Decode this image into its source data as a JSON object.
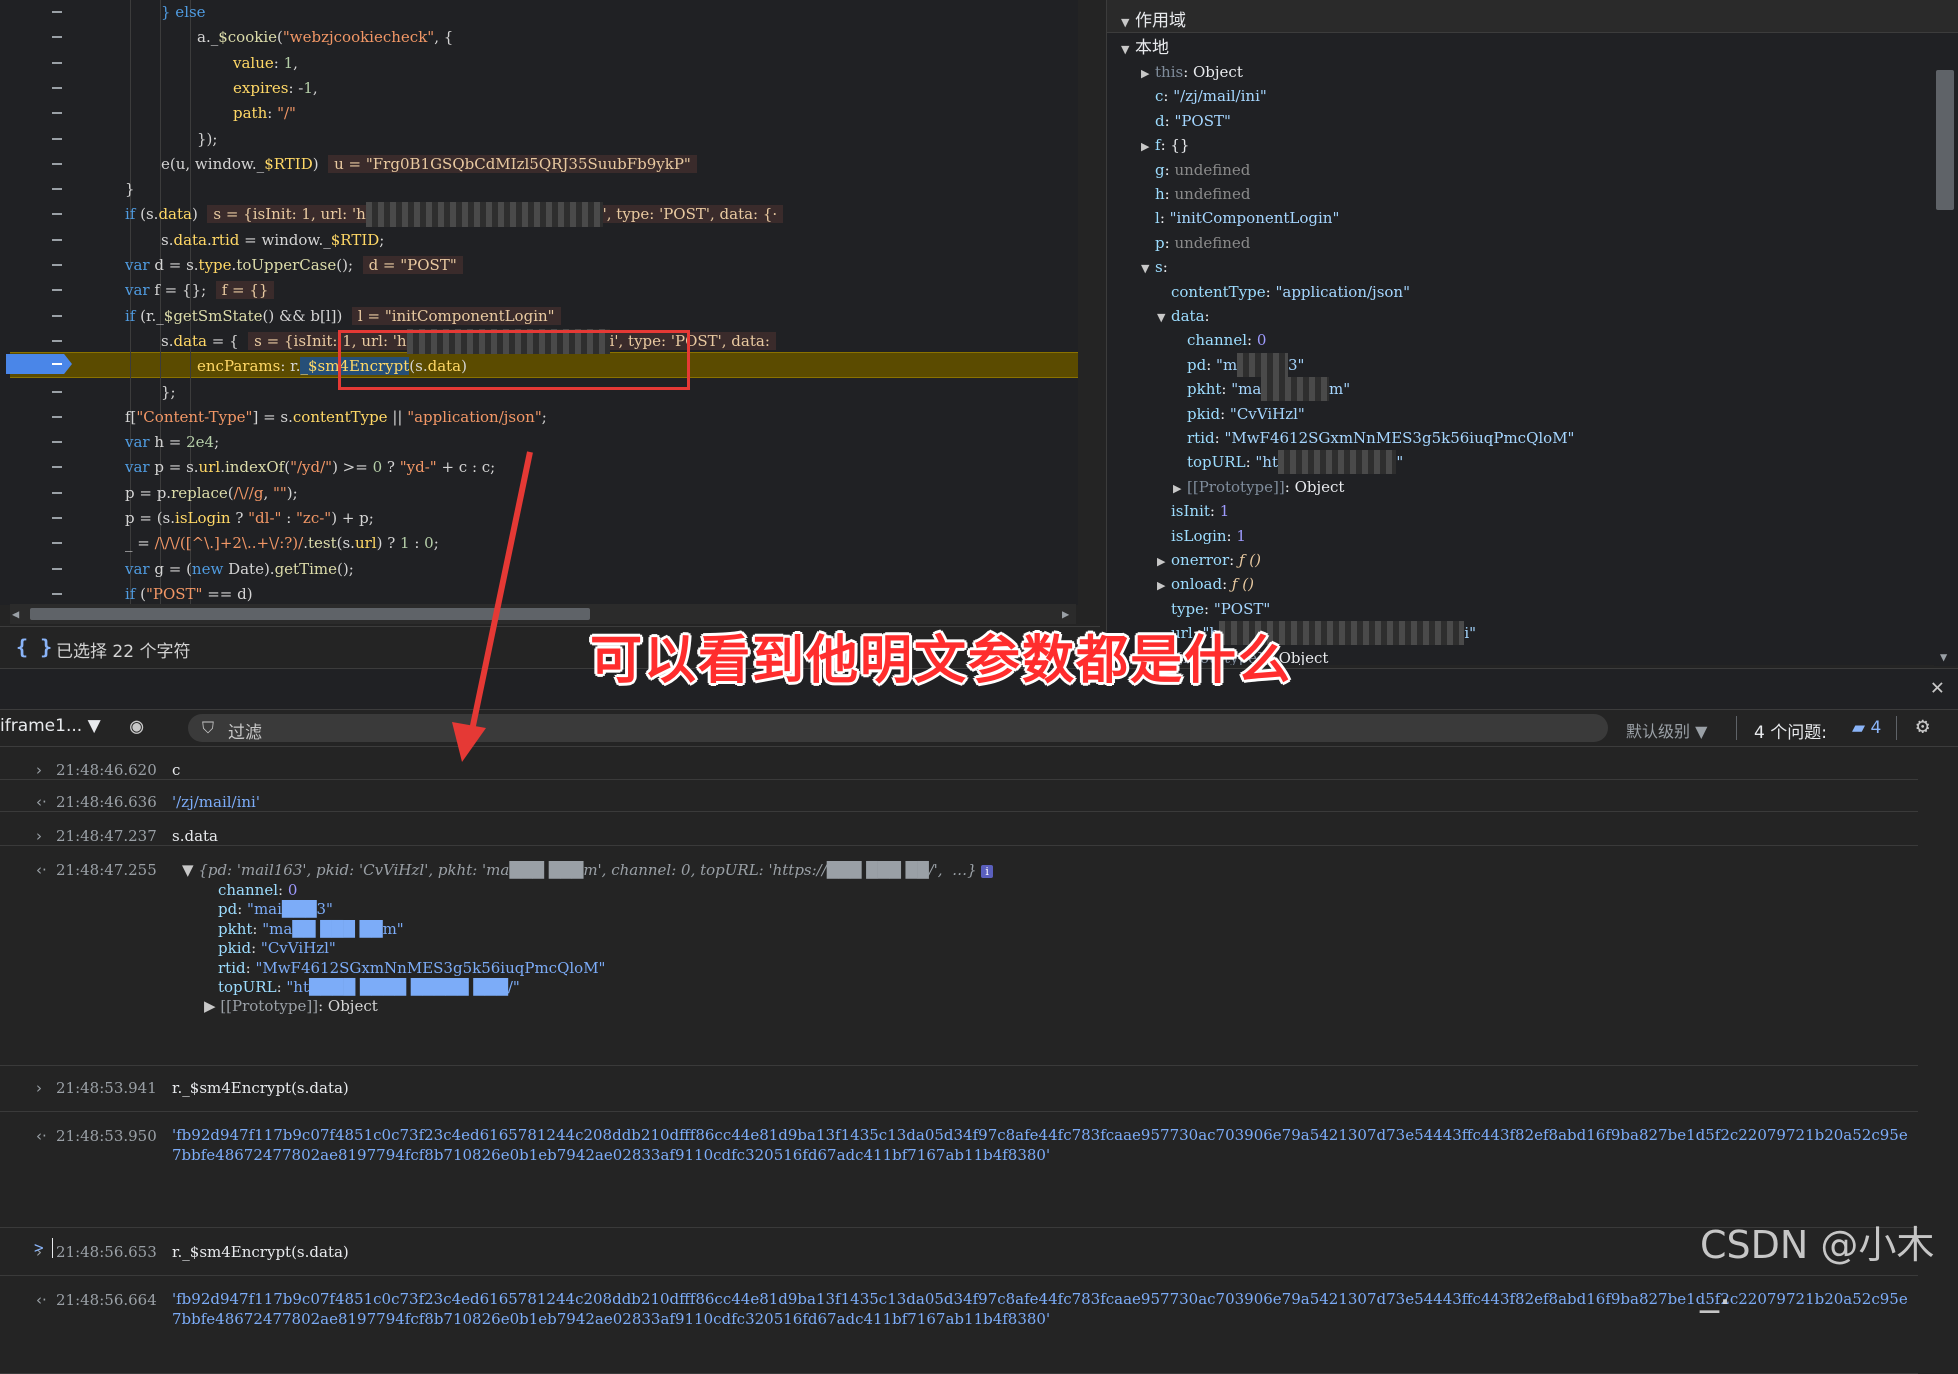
{
  "source": {
    "lines": [
      {
        "indent": 3,
        "html": "<span class='kw'>} else</span>"
      },
      {
        "indent": 4,
        "html": "a._<span class='fn'>$cookie</span>(<span class='str'>\"webzjcookiecheck\"</span>, {"
      },
      {
        "indent": 5,
        "html": "<span class='prop'>value</span>: <span class='num'>1</span>,"
      },
      {
        "indent": 5,
        "html": "<span class='prop'>expires</span>: -<span class='num'>1</span>,"
      },
      {
        "indent": 5,
        "html": "<span class='prop'>path</span>: <span class='str'>\"/\"</span>"
      },
      {
        "indent": 4,
        "html": "});"
      },
      {
        "indent": 3,
        "html": "e(u, window._<span class='prop'>$RTID</span>)  <span class='inline-val'>u = \"Frg0B1GSQbCdMIzl5QRJ35SuubFb9ykP\"</span>"
      },
      {
        "indent": 2,
        "html": "}"
      },
      {
        "indent": 2,
        "html": "<span class='kw'>if</span> (s.<span class='prop'>data</span>)  <span class='inline-val'>s = {isInit: 1, url: 'h<span class=\"blur\">xxxxxxxxxxxxxxxxxxxxxxxxxxxx</span>', type: 'POST', data: {·</span>"
      },
      {
        "indent": 3,
        "html": "s.<span class='prop'>data</span>.<span class='prop'>rtid</span> = window._<span class='prop'>$RTID</span>;"
      },
      {
        "indent": 2,
        "html": "<span class='kw'>var</span> d = s.<span class='prop'>type</span>.<span class='fn'>toUpperCase</span>();  <span class='inline-val'>d = \"POST\"</span>"
      },
      {
        "indent": 2,
        "html": "<span class='kw'>var</span> f = {};  <span class='inline-val'>f = {}</span>"
      },
      {
        "indent": 2,
        "html": "<span class='kw'>if</span> (r._<span class='fn'>$getSmState</span>() &amp;&amp; b[l])  <span class='inline-val'>l = \"initComponentLogin\"</span>"
      },
      {
        "indent": 3,
        "html": "s.<span class='prop'>data</span> = {  <span class='inline-val'>s = {isInit: 1, url: 'h<span class=\"blur\">xxxxxxxxxxxxxxxxxxxxxxxx</span>i', type: 'POST', data:</span>"
      },
      {
        "indent": 4,
        "html": "<span class='prop'>encParams</span>: r.<span class='sel'>_$sm4Encrypt</span>(s.<span class='prop'>data</span>)"
      },
      {
        "indent": 3,
        "html": "};"
      },
      {
        "indent": 2,
        "html": "f[<span class='str'>\"Content-Type\"</span>] = s.<span class='prop'>contentType</span> || <span class='str'>\"application/json\"</span>;"
      },
      {
        "indent": 2,
        "html": "<span class='kw'>var</span> h = <span class='num'>2e4</span>;"
      },
      {
        "indent": 2,
        "html": "<span class='kw'>var</span> p = s.<span class='prop'>url</span>.<span class='fn'>indexOf</span>(<span class='str'>\"/yd/\"</span>) &gt;= <span class='num'>0</span> ? <span class='str'>\"yd-\"</span> + c : c;"
      },
      {
        "indent": 2,
        "html": "p = p.<span class='fn'>replace</span>(<span class='str'>/\\//g</span>, <span class='str'>\"\"</span>);"
      },
      {
        "indent": 2,
        "html": "p = (s.<span class='prop'>isLogin</span> ? <span class='str'>\"dl-\"</span> : <span class='str'>\"zc-\"</span>) + p;"
      },
      {
        "indent": 2,
        "html": "_ = <span class='str'>/\\/\\/([^\\.]+2\\..+\\/:?)/</span>.<span class='fn'>test</span>(s.<span class='prop'>url</span>) ? <span class='num'>1</span> : <span class='num'>0</span>;"
      },
      {
        "indent": 2,
        "html": "<span class='kw'>var</span> g = (<span class='kw'>new</span> Date).<span class='fn'>getTime</span>();"
      },
      {
        "indent": 2,
        "html": "<span class='kw'>if</span> (<span class='str'>\"POST\"</span> == d)"
      }
    ]
  },
  "status": {
    "text": "已选择 22 个字符",
    "braces": "{ }"
  },
  "scope": {
    "header": "作用域",
    "local_label": "本地",
    "rows": [
      {
        "depth": 1,
        "tri": "▶",
        "html": "<span class='sk-dim'>this</span><span class='sv-plain'>: Object</span>"
      },
      {
        "depth": 1,
        "tri": "",
        "html": "<span class='sk'>c</span><span class='sv-plain'>: </span><span class='sv-str'>\"/zj/mail/ini\"</span>"
      },
      {
        "depth": 1,
        "tri": "",
        "html": "<span class='sk'>d</span><span class='sv-plain'>: </span><span class='sv-str'>\"POST\"</span>"
      },
      {
        "depth": 1,
        "tri": "▶",
        "html": "<span class='sk'>f</span><span class='sv-plain'>: {}</span>"
      },
      {
        "depth": 1,
        "tri": "",
        "html": "<span class='sk'>g</span><span class='sv-plain'>: </span><span class='sv-undef'>undefined</span>"
      },
      {
        "depth": 1,
        "tri": "",
        "html": "<span class='sk'>h</span><span class='sv-plain'>: </span><span class='sv-undef'>undefined</span>"
      },
      {
        "depth": 1,
        "tri": "",
        "html": "<span class='sk'>l</span><span class='sv-plain'>: </span><span class='sv-str'>\"initComponentLogin\"</span>"
      },
      {
        "depth": 1,
        "tri": "",
        "html": "<span class='sk'>p</span><span class='sv-plain'>: </span><span class='sv-undef'>undefined</span>"
      },
      {
        "depth": 1,
        "tri": "▼",
        "html": "<span class='sk'>s</span><span class='sv-plain'>:</span>"
      },
      {
        "depth": 2,
        "tri": "",
        "html": "<span class='sk'>contentType</span><span class='sv-plain'>: </span><span class='sv-str'>\"application/json\"</span>"
      },
      {
        "depth": 2,
        "tri": "▼",
        "html": "<span class='sk'>data</span><span class='sv-plain'>:</span>"
      },
      {
        "depth": 3,
        "tri": "",
        "html": "<span class='sk'>channel</span><span class='sv-plain'>: </span><span class='sv-num'>0</span>"
      },
      {
        "depth": 3,
        "tri": "",
        "html": "<span class='sk'>pd</span><span class='sv-plain'>: </span><span class='sv-str'>\"m<span class=\"blur\">xxxxxx</span>3\"</span>"
      },
      {
        "depth": 3,
        "tri": "",
        "html": "<span class='sk'>pkht</span><span class='sv-plain'>: </span><span class='sv-str'>\"ma<span class=\"blur\">xxxxxxxx</span>m\"</span>"
      },
      {
        "depth": 3,
        "tri": "",
        "html": "<span class='sk'>pkid</span><span class='sv-plain'>: </span><span class='sv-str'>\"CvViHzl\"</span>"
      },
      {
        "depth": 3,
        "tri": "",
        "html": "<span class='sk'>rtid</span><span class='sv-plain'>: </span><span class='sv-str'>\"MwF4612SGxmNnMES3g5k56iuqPmcQloM\"</span>"
      },
      {
        "depth": 3,
        "tri": "",
        "html": "<span class='sk'>topURL</span><span class='sv-plain'>: </span><span class='sv-str'>\"ht<span class=\"blur\">xxxxxxxxxxxxxx</span>\"</span>"
      },
      {
        "depth": 3,
        "tri": "▶",
        "html": "<span class='sk-dim'>[[Prototype]]</span><span class='sv-plain'>: Object</span>"
      },
      {
        "depth": 2,
        "tri": "",
        "html": "<span class='sk'>isInit</span><span class='sv-plain'>: </span><span class='sv-num'>1</span>"
      },
      {
        "depth": 2,
        "tri": "",
        "html": "<span class='sk'>isLogin</span><span class='sv-plain'>: </span><span class='sv-num'>1</span>"
      },
      {
        "depth": 2,
        "tri": "▶",
        "html": "<span class='sk'>onerror</span><span class='sv-plain'>: </span><span class='sv-fn'>ƒ ()</span>"
      },
      {
        "depth": 2,
        "tri": "▶",
        "html": "<span class='sk'>onload</span><span class='sv-plain'>: </span><span class='sv-fn'>ƒ ()</span>"
      },
      {
        "depth": 2,
        "tri": "",
        "html": "<span class='sk'>type</span><span class='sv-plain'>: </span><span class='sv-str'>\"POST\"</span>"
      },
      {
        "depth": 2,
        "tri": "",
        "html": "<span class='sk'>url</span><span class='sv-plain'>: </span><span class='sv-str'>\"h<span class=\"blur\">xxxxxxxxxxxxxxxxxxxxxxxxxxxxx</span>i\"</span>"
      },
      {
        "depth": 2,
        "tri": "▶",
        "html": "<span class='sk-dim'>[[Prototype]]</span><span class='sv-plain'>: Object</span>"
      }
    ]
  },
  "console": {
    "context": "iframe1... ▼",
    "filter_label": "过滤",
    "level": "默认级别 ▼",
    "issues_label": "4 个问题:",
    "issues_count": "4",
    "entries": [
      {
        "dir": ">",
        "ts": "21:48:46.620",
        "text": "c"
      },
      {
        "dir": "<",
        "ts": "21:48:46.636",
        "text": "'/zj/mail/ini'"
      },
      {
        "dir": ">",
        "ts": "21:48:47.237",
        "text": "s.data"
      },
      {
        "dir": "<",
        "ts": "21:48:47.255",
        "text": "obj"
      },
      {
        "dir": ">",
        "ts": "21:48:53.941",
        "text": "r._$sm4Encrypt(s.data)"
      },
      {
        "dir": "<",
        "ts": "21:48:53.950",
        "text": "'fb92d947f117b9c07f4851c0c73f23c4ed6165781244c208ddb210dfff86cc44e81d9ba13f1435c13da05d34f97c8afe44fc783fcaae957730ac703906e79a5421307d73e54443ffc443f82ef8abd16f9ba827be1d5f2c22079721b20a52c95e7bbfe48672477802ae8197794fcf8b710826e0b1eb7942ae02833af9110cdfc320516fd67adc411bf7167ab11b4f8380'"
      },
      {
        "dir": ">",
        "ts": "21:48:56.653",
        "text": "r._$sm4Encrypt(s.data)"
      },
      {
        "dir": "<",
        "ts": "21:48:56.664",
        "text": "'fb92d947f117b9c07f4851c0c73f23c4ed6165781244c208ddb210dfff86cc44e81d9ba13f1435c13da05d34f97c8afe44fc783fcaae957730ac703906e79a5421307d73e54443ffc443f82ef8abd16f9ba827be1d5f2c22079721b20a52c95e7bbfe48672477802ae8197794fcf8b710826e0b1eb7942ae02833af9110cdfc320516fd67adc411bf7167ab11b4f8380'"
      }
    ],
    "object_preview": "{pd: 'mail163', pkid: 'CvViHzl', pkht: 'ma███ ███m', channel: 0, topURL: 'https://███ ███ ██/',  …}",
    "object_props": [
      {
        "k": "channel",
        "v": "0",
        "t": "num"
      },
      {
        "k": "pd",
        "v": "\"mai███3\"",
        "t": "str"
      },
      {
        "k": "pkht",
        "v": "\"ma██ ███ ██m\"",
        "t": "str"
      },
      {
        "k": "pkid",
        "v": "\"CvViHzl\"",
        "t": "str"
      },
      {
        "k": "rtid",
        "v": "\"MwF4612SGxmNnMES3g5k56iuqPmcQloM\"",
        "t": "str"
      },
      {
        "k": "topURL",
        "v": "\"ht████ ████ █████ ███/\"",
        "t": "str"
      },
      {
        "k": "[[Prototype]]",
        "v": "Object",
        "t": "plain"
      }
    ]
  },
  "annotation": {
    "text": "可以看到他明文参数都是什么",
    "color": "#ff2d2d"
  },
  "watermark": "CSDN @小木_.",
  "colors": {
    "breakpoint": "#4a86e8",
    "highlight_line": "#5b4b00",
    "red_box": "#e53935"
  }
}
